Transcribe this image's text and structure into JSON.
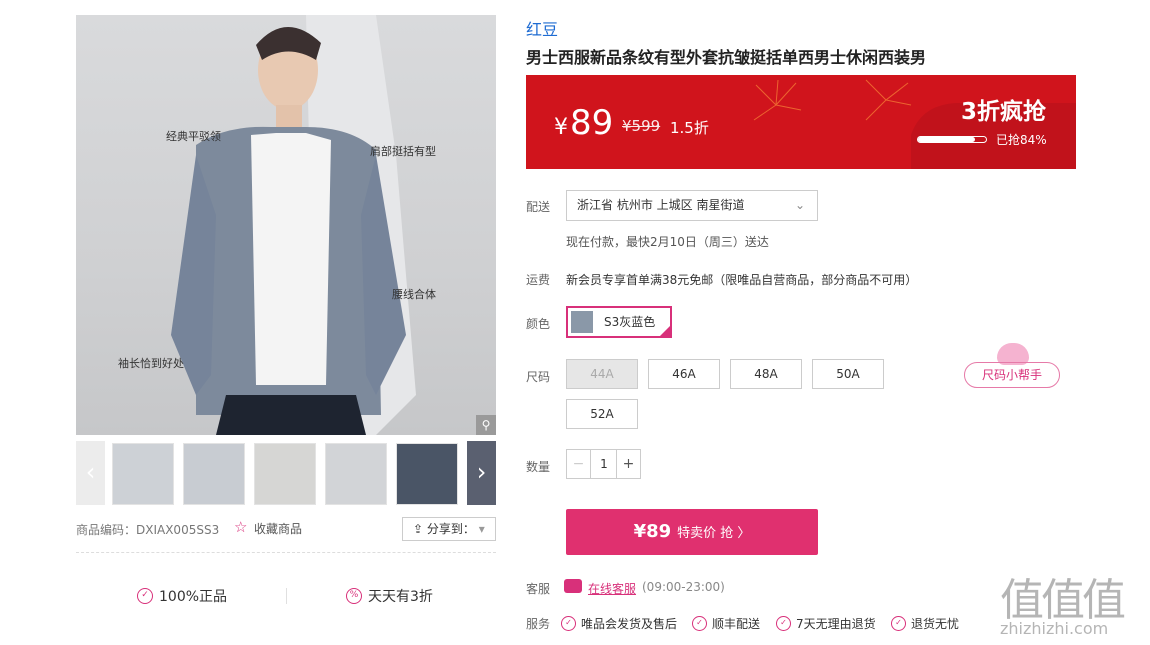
{
  "gallery": {
    "callouts": [
      "经典平驳领",
      "肩部挺括有型",
      "腰线合体",
      "袖长恰到好处"
    ],
    "zoom_icon": "magnifier-icon",
    "prev_icon": "chevron-left-icon",
    "next_icon": "chevron-right-icon"
  },
  "product_meta": {
    "code_label": "商品编码：DXIAX005SS3",
    "favorite_label": "收藏商品",
    "share_label": "分享到："
  },
  "guarantees": [
    "100%正品",
    "天天有3折"
  ],
  "product": {
    "brand": "红豆",
    "title": "男士西服新品条纹有型外套抗皱挺括单西男士休闲西装男"
  },
  "banner": {
    "currency": "¥",
    "price": "89",
    "original_price": "¥599",
    "discount": "1.5折",
    "promo_tag": "3折疯抢",
    "sold_label": "已抢84%",
    "sold_fraction": 0.84,
    "bg_color": "#d0141c"
  },
  "delivery": {
    "label": "配送",
    "address": "浙江省 杭州市 上城区 南星街道",
    "estimate": "现在付款，最快2月10日（周三）送达"
  },
  "shipping": {
    "label": "运费",
    "text": "新会员专享首单满38元免邮（限唯品自营商品，部分商品不可用）"
  },
  "color": {
    "label": "颜色",
    "selected": "S3灰蓝色"
  },
  "size": {
    "label": "尺码",
    "options": [
      "44A",
      "46A",
      "48A",
      "50A",
      "52A"
    ],
    "helper": "尺码小帮手"
  },
  "quantity": {
    "label": "数量",
    "value": "1",
    "minus": "−",
    "plus": "+"
  },
  "buy": {
    "price": "¥89",
    "text": "特卖价 抢 〉"
  },
  "service_contact": {
    "label": "客服",
    "link": "在线客服",
    "hours": "(09:00-23:00)"
  },
  "services": {
    "label": "服务",
    "items": [
      "唯品会发货及售后",
      "顺丰配送",
      "7天无理由退货",
      "退货无忧"
    ]
  },
  "watermark": {
    "logo": "值值值",
    "url": "zhizhizhi.com"
  },
  "colors": {
    "accent": "#d8307a",
    "buy_button": "#e0306f",
    "brand_link": "#1e6bd2"
  }
}
